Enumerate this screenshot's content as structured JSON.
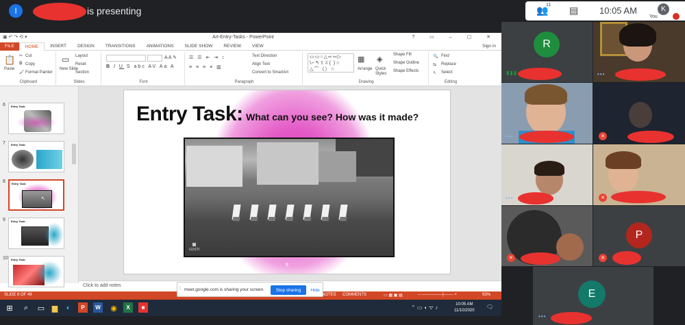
{
  "meet": {
    "presenter_initial": "I",
    "presenting_suffix": "is presenting",
    "participant_count": "11",
    "time": "10:05 AM",
    "you_initial": "K",
    "you_label": "You",
    "participants": [
      {
        "initial": "R",
        "avatar_color": "#1e8e3e"
      },
      {
        "initial": "P",
        "avatar_color": "#b3261e"
      },
      {
        "initial": "E",
        "avatar_color": "#137a6a"
      }
    ]
  },
  "ppt": {
    "window_title": "Art-Entry-Tasks - PowerPoint",
    "window_controls": "? ▭ – ▢ ✕",
    "sign_in": "Sign in",
    "tabs": [
      "FILE",
      "HOME",
      "INSERT",
      "DESIGN",
      "TRANSITIONS",
      "ANIMATIONS",
      "SLIDE SHOW",
      "REVIEW",
      "VIEW"
    ],
    "ribbon": {
      "paste": "Paste",
      "cut": "Cut",
      "copy": "Copy",
      "format_painter": "Format Painter",
      "clipboard": "Clipboard",
      "new_slide": "New Slide",
      "layout": "Layout",
      "reset": "Reset",
      "section": "Section",
      "slides": "Slides",
      "font": "Font",
      "text_direction": "Text Direction",
      "align_text": "Align Text",
      "convert_smartart": "Convert to SmartArt",
      "paragraph": "Paragraph",
      "arrange": "Arrange",
      "quick_styles": "Quick Styles",
      "shape_fill": "Shape Fill",
      "shape_outline": "Shape Outline",
      "shape_effects": "Shape Effects",
      "drawing": "Drawing",
      "find": "Find",
      "replace": "Replace",
      "select": "Select",
      "editing": "Editing"
    },
    "thumbnails": [
      {
        "num": "6",
        "label": "Entry Task:"
      },
      {
        "num": "7",
        "label": "Entry Task:"
      },
      {
        "num": "8",
        "label": "Entry Task:"
      },
      {
        "num": "9",
        "label": "Entry Task:"
      },
      {
        "num": "10",
        "label": "Entry Task:"
      }
    ],
    "slide": {
      "title_big": "Entry Task:",
      "title_small": "What can you see? How was it made?",
      "photo_logo": "GUSTI",
      "page_number": "8"
    },
    "notes_placeholder": "Click to add notes",
    "status": {
      "slide_info": "SLIDE 8 OF 49",
      "notes": "NOTES",
      "comments": "COMMENTS",
      "zoom": "93%"
    }
  },
  "share_bar": {
    "message": "meet.google.com is sharing your screen.",
    "stop": "Stop sharing",
    "hide": "Hide"
  },
  "taskbar": {
    "time": "10:05 AM",
    "date": "11/10/2020"
  }
}
